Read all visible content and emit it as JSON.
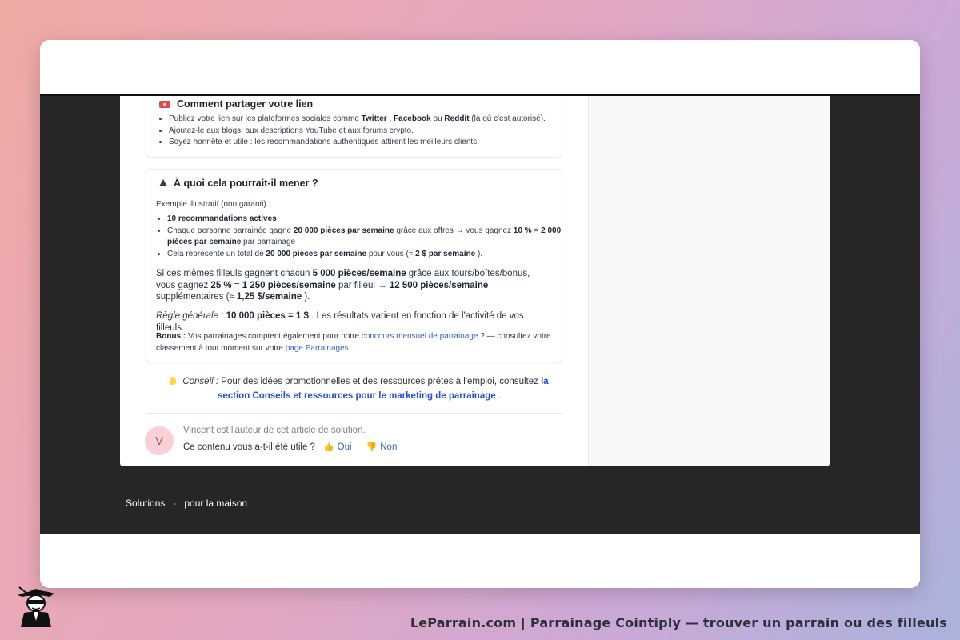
{
  "share_card": {
    "title": "Comment partager votre lien",
    "items": [
      {
        "pre": "Publiez votre lien sur les plateformes sociales comme ",
        "b1": "Twitter",
        "sep1": " , ",
        "b2": "Facebook",
        "sep2": " ou ",
        "b3": "Reddit",
        "post": " (là où c'est autorisé)."
      },
      {
        "text": "Ajoutez-le aux blogs, aux descriptions YouTube et aux forums crypto."
      },
      {
        "text": "Soyez honnête et utile : les recommandations authentiques attirent les meilleurs clients."
      }
    ]
  },
  "result_card": {
    "title": "À quoi cela pourrait-il mener ?",
    "intro": "Exemple illustratif (non garanti) :",
    "item1": "10 recommandations actives",
    "item2": {
      "pre": "Chaque personne parrainée gagne ",
      "b1": "20 000 pièces par semaine",
      "mid": " grâce aux offres → vous gagnez ",
      "b2": "10 %",
      "eq": " = ",
      "b3": "2 000 pièces par semaine",
      "post": " par parrainage"
    },
    "item3": {
      "pre": "Cela représente un total de ",
      "b1": "20 000 pièces par semaine",
      "mid": " pour vous (≈ ",
      "b2": "2 $ par semaine",
      "post": " )."
    },
    "para1": {
      "pre": "Si ces mêmes filleuls gagnent chacun ",
      "b1": "5 000 pièces/semaine",
      "mid1": " grâce aux tours/boîtes/bonus, vous gagnez ",
      "b2": "25 %",
      "mid2": " = ",
      "b3": "1 250 pièces/semaine",
      "mid3": " par filleul → ",
      "b4": "12 500 pièces/semaine",
      "mid4": " supplémentaires (≈ ",
      "b5": "1,25 $/semaine",
      "post": " )."
    },
    "para2": {
      "italic": "Règle générale :",
      "b1": "10 000 pièces = 1 $",
      "post": " . Les résultats varient en fonction de l'activité de vos filleuls."
    },
    "para3": {
      "b1": "Bonus :",
      "pre": " Vos parrainages comptent également pour notre ",
      "link1": "concours mensuel de parrainage",
      "mid": " ? — consultez votre classement à tout moment sur votre ",
      "link2": "page Parrainages",
      "post": " ."
    }
  },
  "tip": {
    "italic": "Conseil :",
    "text": " Pour des idées promotionnelles et des ressources prêtes à l'emploi, consultez ",
    "link": "la section Conseils et ressources pour le marketing de parrainage",
    "post": " ."
  },
  "author": {
    "initial": "V",
    "text": "Vincent est l'auteur de cet article de solution."
  },
  "feedback": {
    "question": "Ce contenu vous a-t-il été utile ?",
    "yes": "Oui",
    "no": "Non"
  },
  "footer": {
    "item1": "Solutions",
    "separator": "-",
    "item2": "pour la maison"
  },
  "caption": "LeParrain.com | Parrainage Cointiply — trouver un parrain ou des filleuls",
  "icons": {
    "share": "ticket-icon",
    "result": "hat-icon",
    "tip": "lightbulb-icon",
    "yes": "thumbs-up-icon",
    "no": "thumbs-down-icon",
    "brand": "spy-logo"
  }
}
